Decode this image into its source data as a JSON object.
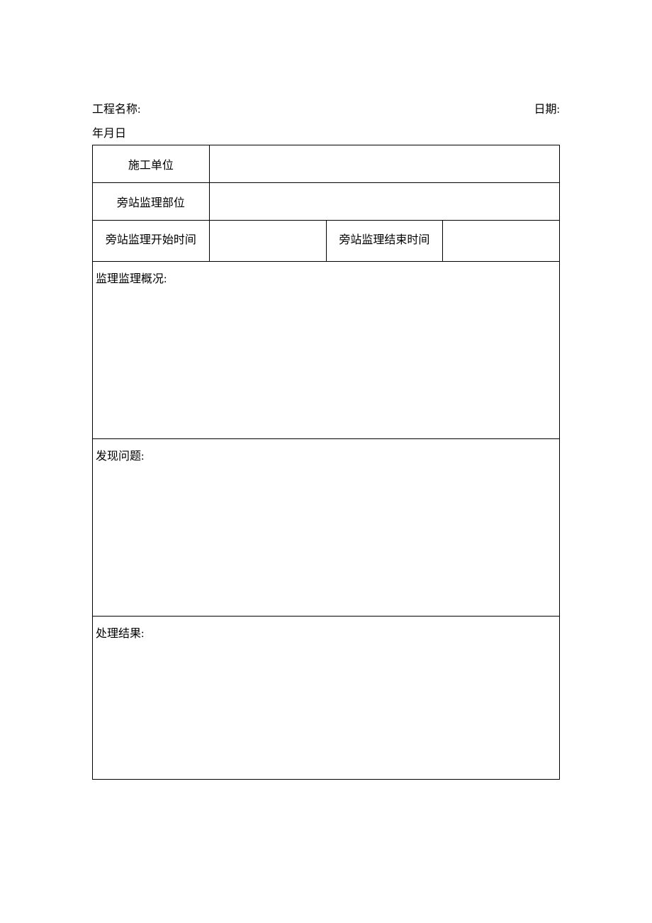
{
  "header": {
    "projectNameLabel": "工程名称:",
    "dateLabel": "日期:",
    "dateLine": "年月日"
  },
  "table": {
    "constructionUnitLabel": "施工单位",
    "constructionUnitValue": "",
    "supervisionPositionLabel": "旁站监理部位",
    "supervisionPositionValue": "",
    "startTimeLabel": "旁站监理开始时间",
    "startTimeValue": "",
    "endTimeLabel": "旁站监理结束时间",
    "endTimeValue": "",
    "overviewLabel": "监理监理概况:",
    "overviewValue": "",
    "issuesLabel": "发现问题:",
    "issuesValue": "",
    "resultLabel": "处理结果:",
    "resultValue": ""
  }
}
